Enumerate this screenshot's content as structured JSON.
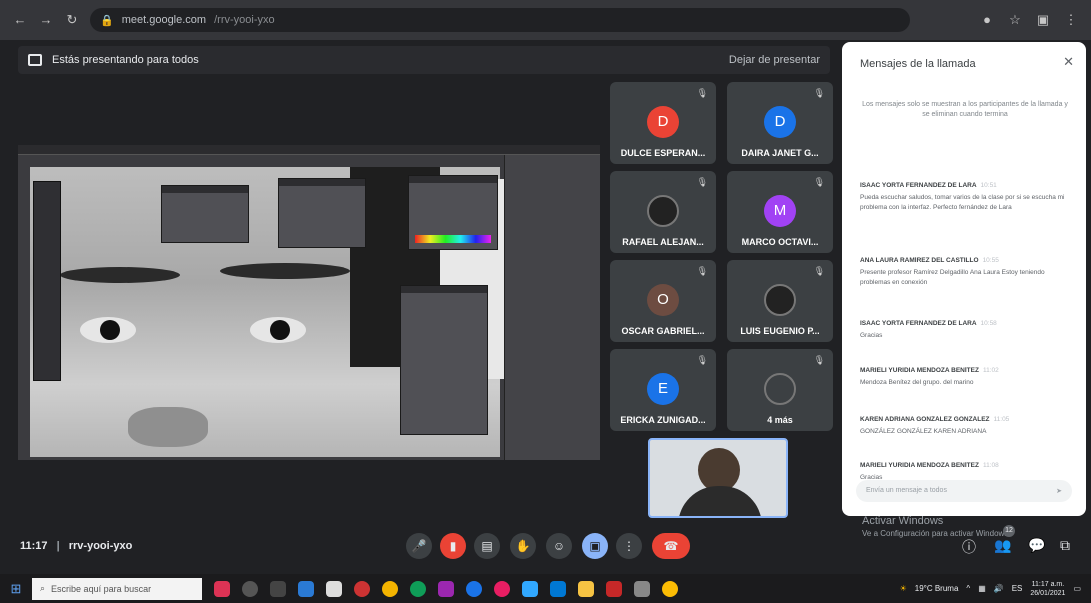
{
  "browser": {
    "url": "meet.google.com",
    "url_rest": "/rrv-yooi-yxo"
  },
  "present_bar": {
    "label": "Estás presentando para todos",
    "stop_label": "Dejar de presentar"
  },
  "participants": [
    {
      "name": "DULCE ESPERAN...",
      "initial": "D",
      "color": "#ea4335"
    },
    {
      "name": "DAIRA JANET G...",
      "initial": "D",
      "color": "#1a73e8"
    },
    {
      "name": "RAFAEL ALEJAN...",
      "initial": "",
      "color": "#222222"
    },
    {
      "name": "MARCO OCTAVI...",
      "initial": "M",
      "color": "#a142f4"
    },
    {
      "name": "OSCAR GABRIEL...",
      "initial": "O",
      "color": "#6d4c41"
    },
    {
      "name": "LUIS EUGENIO P...",
      "initial": "",
      "color": "#222222"
    },
    {
      "name": "ERICKA ZUNIGAD...",
      "initial": "E",
      "color": "#1a73e8"
    },
    {
      "name": "4 más",
      "initial": "",
      "color": "#3c4043"
    }
  ],
  "chat": {
    "title": "Mensajes de la llamada",
    "notice": "Los mensajes solo se muestran a los participantes de la llamada y se eliminan cuando termina",
    "messages": [
      {
        "sender": "ISAAC YORTA FERNÁNDEZ DE LARA",
        "time": "10:51",
        "text": "Pueda escuchar saludos, tomar varios de la clase por si se escucha mi problema con la interfaz. Perfecto fernández de Lara"
      },
      {
        "sender": "ANA LAURA RAMÍREZ DEL CASTILLO",
        "time": "10:55",
        "text": "Presente profesor Ramírez Delgadillo Ana Laura Estoy teniendo problemas en conexión"
      },
      {
        "sender": "ISAAC YORTA FERNÁNDEZ DE LARA",
        "time": "10:58",
        "text": "Gracias"
      },
      {
        "sender": "MARIELI YURIDIA MENDOZA BENÍTEZ",
        "time": "11:02",
        "text": "Mendoza Benítez del grupo. del marino"
      },
      {
        "sender": "KAREN ADRIANA GONZÁLEZ GONZÁLEZ",
        "time": "11:05",
        "text": "GONZÁLEZ GONZÁLEZ KAREN ADRIANA"
      },
      {
        "sender": "MARIELI YURIDIA MENDOZA BENÍTEZ",
        "time": "11:08",
        "text": "Gracias"
      }
    ],
    "input_placeholder": "Envía un mensaje a todos"
  },
  "watermark": {
    "line1": "Activar Windows",
    "line2": "Ve a Configuración para activar Windows."
  },
  "meeting": {
    "time": "11:17",
    "code": "rrv-yooi-yxo",
    "people_count": "12"
  },
  "taskbar": {
    "search_placeholder": "Escribe aquí para buscar",
    "weather": "19°C Bruma",
    "language": "ES",
    "time": "11:17 a.m.",
    "date": "26/01/2021"
  },
  "colors": {
    "meet_bg": "#202124",
    "tile_bg": "#3c4043",
    "hangup": "#ea4335",
    "accent": "#8ab4f8"
  }
}
